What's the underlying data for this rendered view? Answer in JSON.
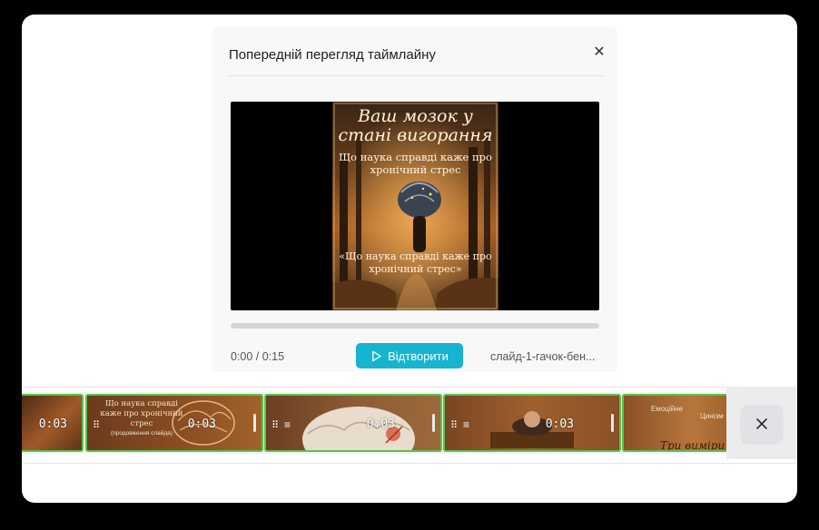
{
  "dialog": {
    "title": "Попередній перегляд таймлайну",
    "close_icon": "close-icon",
    "poster": {
      "title": "Ваш мозок у стані вигорання",
      "subtitle": "Що наука справді каже про хронічний стрес",
      "quote": "«Що наука справді каже про хронічний стрес»"
    },
    "progress_fraction": 0,
    "time": "0:00 / 0:15",
    "play_label": "Відтворити",
    "play_icon": "play-icon",
    "file_name": "слайд-1-гачок-бен..."
  },
  "timeline": {
    "clips": [
      {
        "duration": "0:03",
        "text": ""
      },
      {
        "duration": "0:03",
        "text_main": "Що наука справді каже про хронічний стрес",
        "text_note": "(продовження слайда)"
      },
      {
        "duration": "0:03",
        "text": ""
      },
      {
        "duration": "0:03",
        "text": ""
      },
      {
        "duration": "",
        "text_a": "Емоційне",
        "text_b": "Цинізм",
        "text_c": "Три виміри"
      }
    ],
    "close_icon": "close-icon"
  },
  "colors": {
    "accent": "#16b4cf",
    "clip_border": "#5ac24a"
  }
}
